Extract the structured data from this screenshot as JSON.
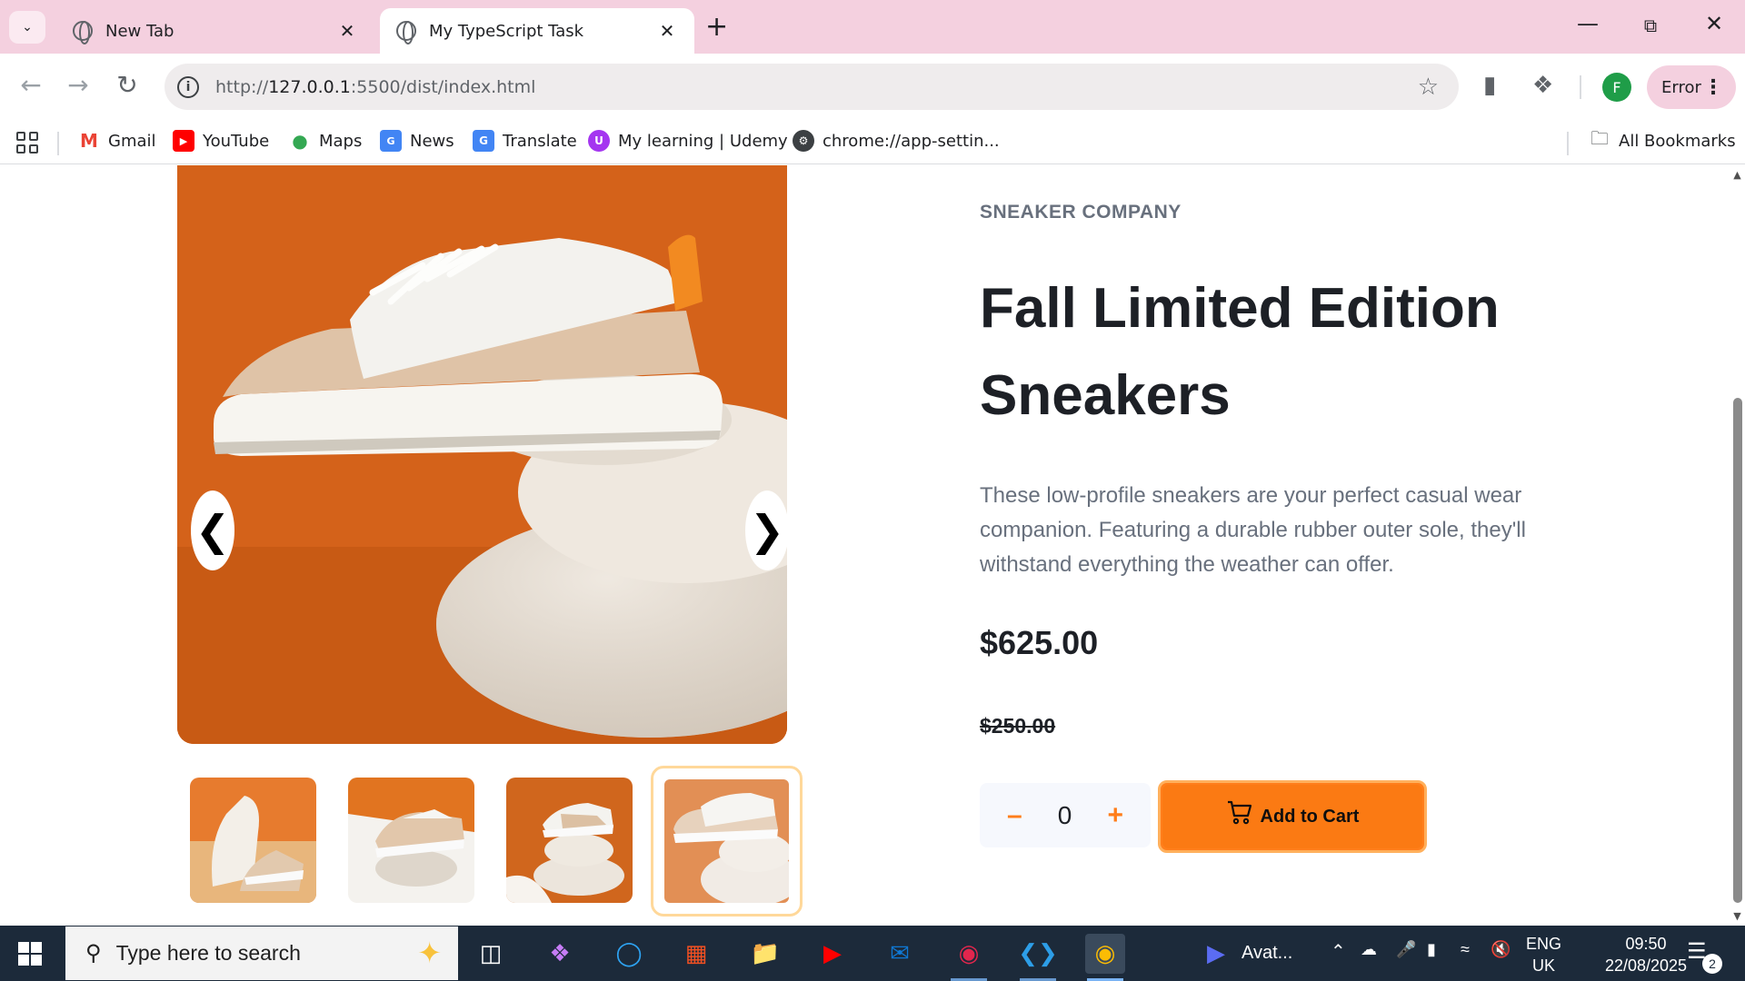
{
  "browser": {
    "tabs": [
      {
        "title": "New Tab",
        "active": false
      },
      {
        "title": "My TypeScript Task",
        "active": true
      }
    ],
    "url": {
      "prefix": "http://",
      "host": "127.0.0.1",
      "rest": ":5500/dist/index.html"
    },
    "profile_initial": "F",
    "error_label": "Error",
    "bookmarks": [
      {
        "label": "Gmail",
        "icon": "gmail-icon"
      },
      {
        "label": "YouTube",
        "icon": "youtube-icon"
      },
      {
        "label": "Maps",
        "icon": "maps-icon"
      },
      {
        "label": "News",
        "icon": "news-icon"
      },
      {
        "label": "Translate",
        "icon": "translate-icon"
      },
      {
        "label": "My learning | Udemy",
        "icon": "udemy-icon"
      },
      {
        "label": "chrome://app-settin...",
        "icon": "chrome-settings-icon"
      }
    ],
    "all_bookmarks": "All Bookmarks"
  },
  "product": {
    "company": "SNEAKER COMPANY",
    "title": "Fall Limited Edition Sneakers",
    "description": "These low-profile sneakers are your perfect casual wear companion. Featuring a durable rubber outer sole, they'll withstand everything the weather can offer.",
    "price": "$625.00",
    "old_price": "$250.00",
    "quantity": "0",
    "minus": "–",
    "plus": "+",
    "add_to_cart": "Add to Cart",
    "carousel_prev": "❮",
    "carousel_next": "❯",
    "thumbnails_count": 4,
    "selected_thumbnail": 4
  },
  "colors": {
    "accent_orange": "#ff7e1b",
    "hero_orange": "#d4621a",
    "tab_strip": "#f4d0df",
    "taskbar": "#1c2a3a"
  },
  "taskbar": {
    "search_placeholder": "Type here to search",
    "zoom_label": "Avat...",
    "lang_line1": "ENG",
    "lang_line2": "UK",
    "time": "09:50",
    "date": "22/08/2025",
    "notifications": "2"
  }
}
